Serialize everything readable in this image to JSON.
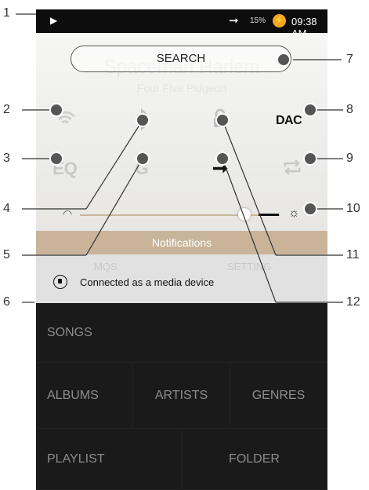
{
  "status_bar": {
    "play_icon": "play-icon",
    "arrow_icon": "arrow-right-icon",
    "battery": "15%",
    "charging_icon": "lightning-icon",
    "time": "09:38 AM"
  },
  "quick_panel": {
    "ghost_title": "Spaceman Harlem",
    "ghost_subtitle": "Four Five Pidgeon",
    "search_label": "SEARCH",
    "tiles": {
      "wifi": "wifi-icon",
      "bluetooth": "bluetooth-icon",
      "lock": "lock-icon",
      "dac_label": "DAC",
      "eq_label": "EQ",
      "gapless_label": "G",
      "line_out": "arrow-right-icon",
      "repeat": "repeat-icon"
    },
    "brightness_icon": "sun-icon"
  },
  "notifications": {
    "header": "Notifications",
    "behind_left": "MQS",
    "behind_right": "SETTING",
    "message": "Connected as a media device"
  },
  "menu": {
    "songs": "SONGS",
    "albums": "ALBUMS",
    "artists": "ARTISTS",
    "genres": "GENRES",
    "playlist": "PLAYLIST",
    "folder": "FOLDER"
  },
  "callouts": {
    "c1": "1",
    "c2": "2",
    "c3": "3",
    "c4": "4",
    "c5": "5",
    "c6": "6",
    "c7": "7",
    "c8": "8",
    "c9": "9",
    "c10": "10",
    "c11": "11",
    "c12": "12"
  },
  "colors": {
    "panel": "#eeeeec",
    "notif_header": "#c9b49a",
    "charging": "#f5a623",
    "menu_bg": "#1a1a1a"
  }
}
